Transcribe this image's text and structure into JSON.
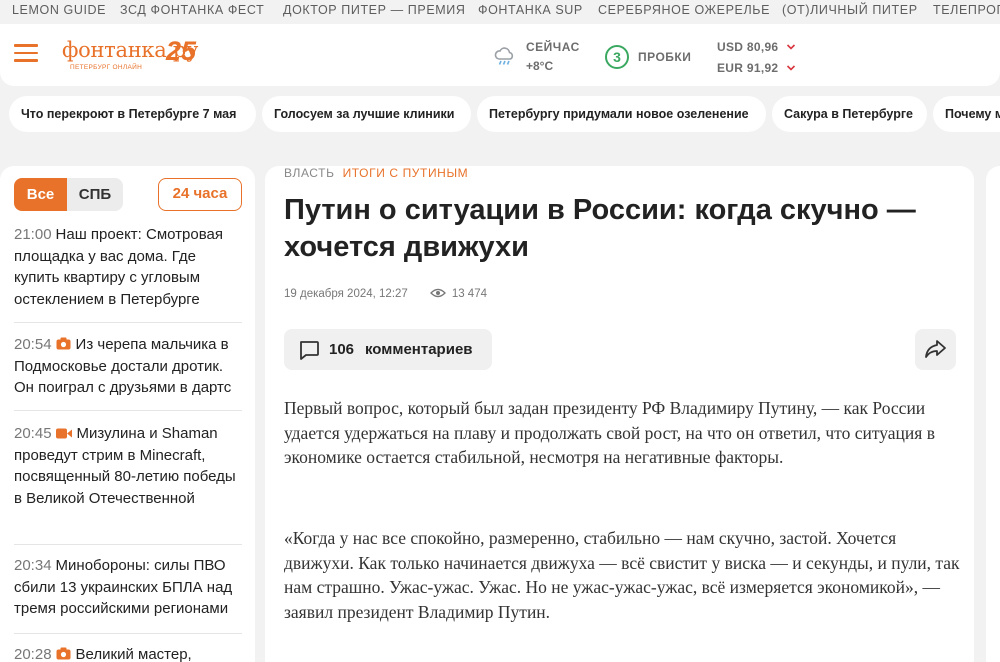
{
  "top_nav": [
    "LEMON GUIDE",
    "ЗСД ФОНТАНКА ФЕСТ",
    "ДОКТОР ПИТЕР — ПРЕМИЯ",
    "ФОНТАНКА SUP",
    "СЕРЕБРЯНОЕ ОЖЕРЕЛЬЕ",
    "(ОТ)ЛИЧНЫЙ ПИТЕР",
    "ТЕЛЕПРОГ"
  ],
  "header": {
    "logo_text": "фонтанка.ру",
    "logo_number": "25",
    "logo_subtitle": "ПЕТЕРБУРГ ОНЛАЙН",
    "weather_label": "СЕЙЧАС",
    "weather_temp": "+8°C",
    "traffic_score": "3",
    "traffic_label": "ПРОБКИ",
    "usd": "USD 80,96",
    "eur": "EUR 91,92",
    "accent_color": "#e8722a",
    "traffic_color": "#3aa860",
    "down_color": "#d9363e"
  },
  "chips": [
    "Что перекроют в Петербурге 7 мая",
    "Голосуем за лучшие клиники",
    "Петербургу придумали новое озеленение",
    "Сакура в Петербурге",
    "Почему м"
  ],
  "sidebar": {
    "tab_all": "Все",
    "tab_spb": "СПБ",
    "tab_24": "24 часа",
    "news": [
      {
        "time": "21:00",
        "icon": "",
        "text": "Наш проект: Смотровая площадка у вас дома. Где купить квартиру с угловым остеклением в Петербурге"
      },
      {
        "time": "20:54",
        "icon": "camera-icon",
        "text": "Из черепа мальчика в Подмосковье достали дротик. Он поиграл с друзьями в дартс"
      },
      {
        "time": "20:45",
        "icon": "video-icon",
        "text": "Мизулина и Shaman проведут стрим в Minecraft, посвященный 80-летию победы в Великой Отечественной"
      },
      {
        "time": "20:34",
        "icon": "",
        "text": "Минобороны: силы ПВО сбили 13 украинских БПЛА над тремя российскими регионами"
      },
      {
        "time": "20:28",
        "icon": "camera-icon",
        "text": "Великий мастер,"
      }
    ]
  },
  "article": {
    "rubric": "ВЛАСТЬ",
    "tag": "ИТОГИ С ПУТИНЫМ",
    "title": "Путин о ситуации в России: когда скучно — хочется движухи",
    "date": "19 декабря 2024, 12:27",
    "views": "13 474",
    "comments_count": "106",
    "comments_label": "комментариев",
    "paragraphs": [
      "Первый вопрос, который был задан президенту РФ Владимиру Путину, — как России удается удержаться на плаву и продолжать свой рост, на что он ответил, что ситуация в экономике остается стабильной, несмотря на негативные факторы.",
      "«Когда у нас все спокойно, размеренно, стабильно — нам скучно, застой. Хочется движухи. Как только начинается движуха — всё свистит у виска — и секунды, и пули, так нам страшно. Ужас-ужас. Ужас. Но не ужас-ужас-ужас, всё измеряется экономикой», — заявил президент Владимир Путин."
    ]
  }
}
